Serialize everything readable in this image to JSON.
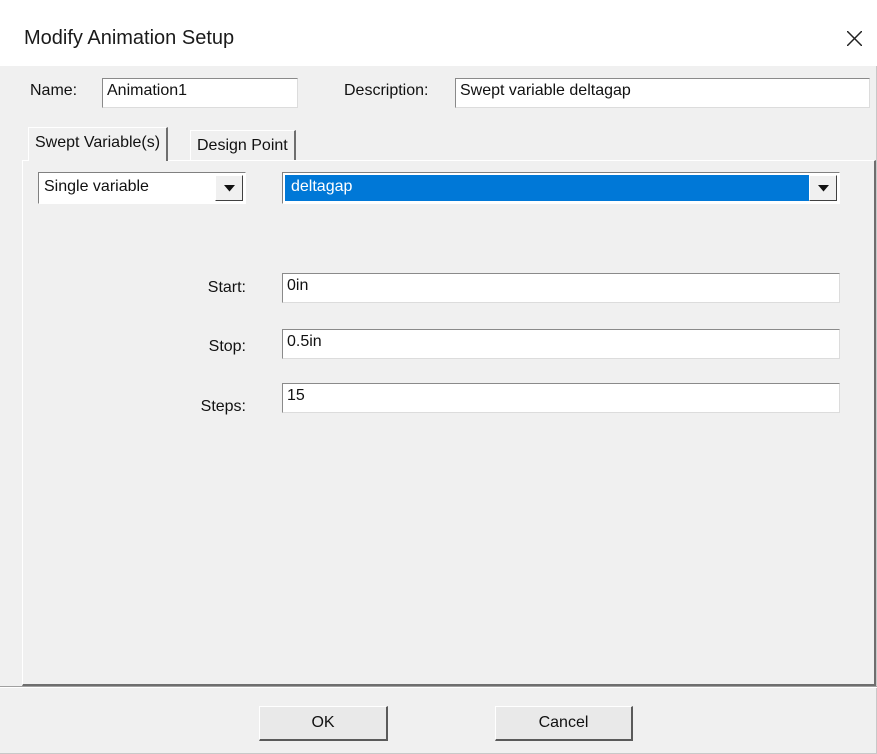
{
  "window": {
    "title": "Modify Animation Setup",
    "close_icon": "close-icon"
  },
  "header": {
    "name_label": "Name:",
    "name_value": "Animation1",
    "description_label": "Description:",
    "description_value": "Swept variable deltagap"
  },
  "tabs": [
    {
      "label": "Swept Variable(s)",
      "active": true
    },
    {
      "label": "Design Point",
      "active": false
    }
  ],
  "swept": {
    "mode_options_selected": "Single variable",
    "variable_selected": "deltagap",
    "start_label": "Start:",
    "start_value": "0in",
    "stop_label": "Stop:",
    "stop_value": "0.5in",
    "steps_label": "Steps:",
    "steps_value": "15"
  },
  "buttons": {
    "ok_label": "OK",
    "cancel_label": "Cancel"
  },
  "colors": {
    "selection_highlight": "#0078d7",
    "dialog_background": "#f0f0f0"
  }
}
